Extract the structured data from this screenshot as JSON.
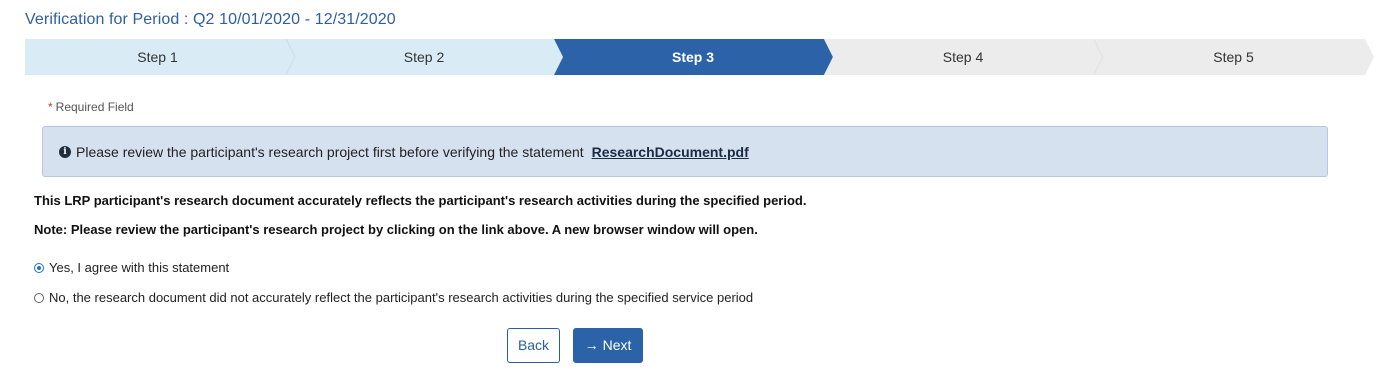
{
  "header": {
    "title": "Verification for Period : Q2 10/01/2020 - 12/31/2020"
  },
  "stepper": {
    "steps": [
      {
        "label": "Step 1",
        "state": "complete"
      },
      {
        "label": "Step 2",
        "state": "complete"
      },
      {
        "label": "Step 3",
        "state": "active"
      },
      {
        "label": "Step 4",
        "state": "upcoming"
      },
      {
        "label": "Step 5",
        "state": "upcoming"
      }
    ],
    "colors": {
      "complete": "#d9ecf6",
      "active": "#2c63a8",
      "upcoming": "#ececec"
    }
  },
  "form": {
    "required_note": "Required Field",
    "alert": {
      "icon": "info-circle-icon",
      "message": "Please review the participant's research project first before verifying the statement",
      "link_text": "ResearchDocument.pdf"
    },
    "statement": "This LRP participant's research document accurately reflects the participant's research activities during the specified period.",
    "note": "Note: Please review the participant's research project by clicking on the link above. A new browser window will open.",
    "options": [
      {
        "label": "Yes, I agree with this statement",
        "checked": true
      },
      {
        "label": "No, the research document did not accurately reflect the participant's research activities during the specified service period",
        "checked": false
      }
    ]
  },
  "actions": {
    "back_label": "Back",
    "next_label": "Next",
    "next_icon": "arrow-right-icon"
  }
}
